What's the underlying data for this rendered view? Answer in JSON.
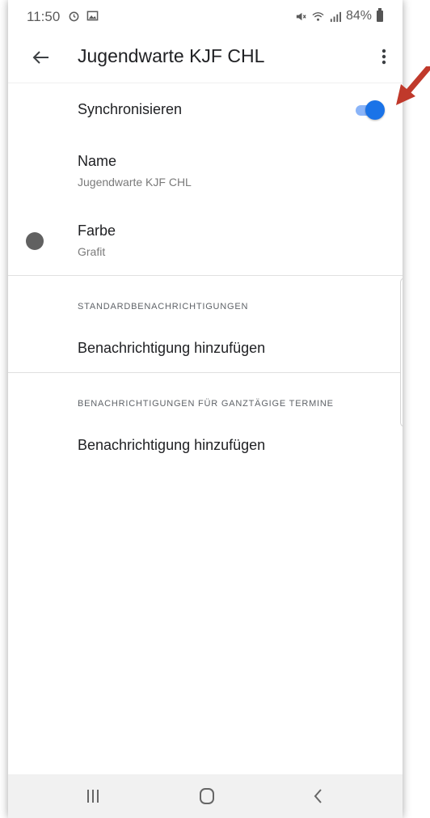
{
  "status_bar": {
    "time": "11:50",
    "battery": "84%"
  },
  "app_bar": {
    "title": "Jugendwarte KJF CHL"
  },
  "settings": {
    "sync_label": "Synchronisieren",
    "sync_enabled": true,
    "name_label": "Name",
    "name_value": "Jugendwarte KJF CHL",
    "color_label": "Farbe",
    "color_value": "Grafit"
  },
  "sections": [
    {
      "header": "STANDARDBENACHRICHTIGUNGEN",
      "action": "Benachrichtigung hinzufügen"
    },
    {
      "header": "BENACHRICHTIGUNGEN FÜR GANZTÄGIGE TERMINE",
      "action": "Benachrichtigung hinzufügen"
    }
  ],
  "colors": {
    "accent": "#1a73e8",
    "toggle_track": "#8ab4f8",
    "graphite": "#616161",
    "annotation_arrow": "#c0392b"
  },
  "icons": {
    "back": "arrow-left",
    "more": "vertical-dots",
    "nav_recent": "three-bars",
    "nav_home": "rounded-square",
    "nav_back": "chevron-left"
  }
}
